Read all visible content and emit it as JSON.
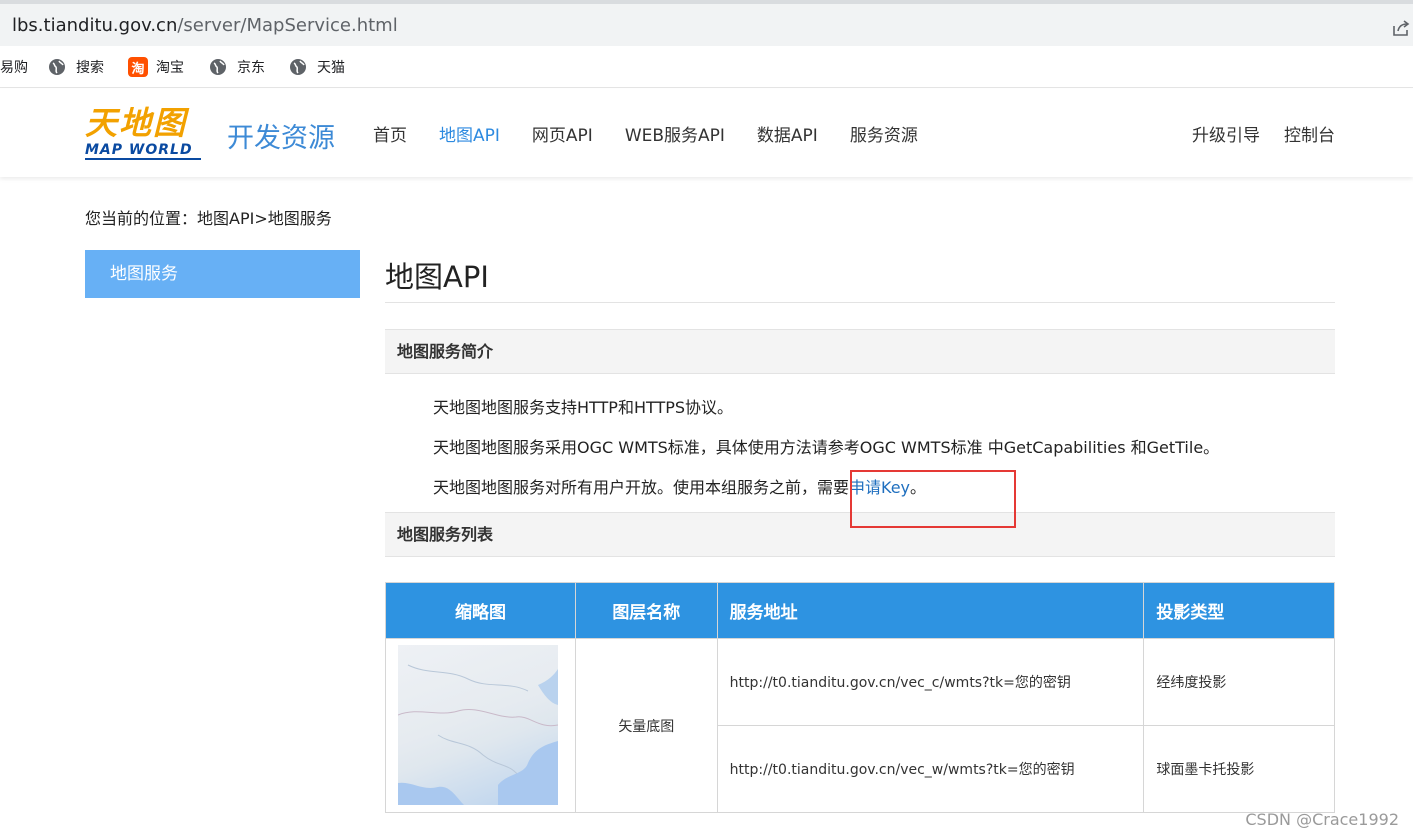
{
  "browser": {
    "url_host": "lbs.tianditu.gov.cn",
    "url_path": "/server/MapService.html",
    "bookmarks": [
      "易购",
      "搜索",
      "淘宝",
      "京东",
      "天猫"
    ]
  },
  "header": {
    "logo_cn": "天地图",
    "logo_en": "MAP WORLD",
    "dev_title": "开发资源",
    "nav": [
      "首页",
      "地图API",
      "网页API",
      "WEB服务API",
      "数据API",
      "服务资源"
    ],
    "nav_active": "地图API",
    "nav_right": [
      "升级引导",
      "控制台"
    ]
  },
  "breadcrumb": "您当前的位置：地图API>地图服务",
  "sidebar": {
    "items": [
      {
        "label": "地图服务"
      }
    ]
  },
  "main": {
    "title": "地图API",
    "intro_heading": "地图服务简介",
    "intro_lines": [
      "天地图地图服务支持HTTP和HTTPS协议。",
      "天地图地图服务采用OGC WMTS标准，具体使用方法请参考OGC WMTS标准 中GetCapabilities 和GetTile。"
    ],
    "intro_line3_pre": "天地图地图服务对所有用户开放。使用本组服务之前，需要",
    "intro_line3_link": "申请Key",
    "intro_line3_post": "。",
    "list_heading": "地图服务列表",
    "table": {
      "headers": [
        "缩略图",
        "图层名称",
        "服务地址",
        "投影类型"
      ],
      "layer_name": "矢量底图",
      "rows": [
        {
          "url": "http://t0.tianditu.gov.cn/vec_c/wmts?tk=您的密钥",
          "projection": "经纬度投影"
        },
        {
          "url": "http://t0.tianditu.gov.cn/vec_w/wmts?tk=您的密钥",
          "projection": "球面墨卡托投影"
        }
      ]
    }
  },
  "watermark": "CSDN @Crace1992",
  "colors": {
    "accent": "#2e93e1",
    "sidebar_active": "#67b0f5",
    "link": "#1f6fbf",
    "highlight_box": "#e53935"
  }
}
